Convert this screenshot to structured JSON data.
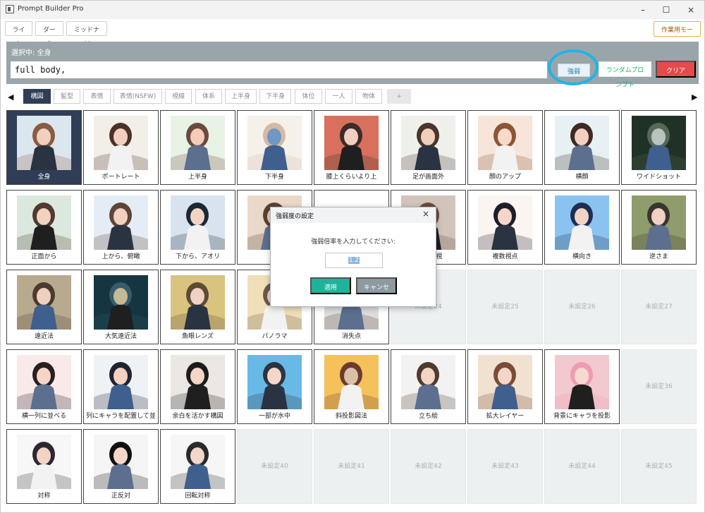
{
  "window": {
    "title": "Prompt Builder Pro"
  },
  "toolbar": {
    "themes": [
      "ライト",
      "ダーク",
      "ミッドナイト"
    ],
    "work_mode": "作業用モード"
  },
  "prompt": {
    "selected_label": "選択中: 全身",
    "value": "full body,",
    "strength_label": "強弱",
    "random_label": "ランダムプロンプト",
    "clear_label": "クリア"
  },
  "tabs": [
    "構図",
    "髪型",
    "表情",
    "表情(NSFW)",
    "視線",
    "体系",
    "上半身",
    "下半身",
    "体位",
    "一人",
    "物体",
    "+"
  ],
  "cards": [
    {
      "label": "全身",
      "icon": "full-body-image"
    },
    {
      "label": "ポートレート",
      "icon": "portrait-image"
    },
    {
      "label": "上半身",
      "icon": "upper-body-image"
    },
    {
      "label": "下半身",
      "icon": "lower-body-image"
    },
    {
      "label": "膝上くらいより上",
      "icon": "above-knees-image"
    },
    {
      "label": "足が画面外",
      "icon": "feet-out-of-frame-image"
    },
    {
      "label": "顔のアップ",
      "icon": "face-closeup-image"
    },
    {
      "label": "横顔",
      "icon": "profile-image"
    },
    {
      "label": "ワイドショット",
      "icon": "wide-shot-image"
    },
    {
      "label": "正面から",
      "icon": "from-front-image"
    },
    {
      "label": "上から、俯瞰",
      "icon": "from-above-image"
    },
    {
      "label": "下から、アオリ",
      "icon": "from-below-image"
    },
    {
      "label": "後",
      "icon": "from-behind-image"
    },
    {
      "label": "",
      "icon": "hidden-image"
    },
    {
      "label": "(斜めの視",
      "icon": "diagonal-view-image"
    },
    {
      "label": "複数視点",
      "icon": "multiple-views-image"
    },
    {
      "label": "横向き",
      "icon": "sideways-image"
    },
    {
      "label": "逆さま",
      "icon": "upside-down-image"
    },
    {
      "label": "遠近法",
      "icon": "perspective-image"
    },
    {
      "label": "大気遠近法",
      "icon": "aerial-perspective-image"
    },
    {
      "label": "魚眼レンズ",
      "icon": "fisheye-image"
    },
    {
      "label": "パノラマ",
      "icon": "panorama-image"
    },
    {
      "label": "消失点",
      "icon": "vanishing-point-image"
    },
    {
      "label": "未設定24",
      "icon": ""
    },
    {
      "label": "未設定25",
      "icon": ""
    },
    {
      "label": "未設定26",
      "icon": ""
    },
    {
      "label": "未設定27",
      "icon": ""
    },
    {
      "label": "横一列に並べる",
      "icon": "line-up-image"
    },
    {
      "label": "列にキャラを配置して並",
      "icon": "character-columns-image"
    },
    {
      "label": "余白を活かす構図",
      "icon": "negative-space-image"
    },
    {
      "label": "一部が水中",
      "icon": "partially-underwater-image"
    },
    {
      "label": "斜投影図法",
      "icon": "oblique-projection-image"
    },
    {
      "label": "立ち絵",
      "icon": "standing-image"
    },
    {
      "label": "拡大レイヤー",
      "icon": "enlarged-layer-image"
    },
    {
      "label": "背景にキャラを投影",
      "icon": "background-character-image"
    },
    {
      "label": "未設定36",
      "icon": ""
    },
    {
      "label": "対称",
      "icon": "symmetry-image"
    },
    {
      "label": "正反対",
      "icon": "opposite-image"
    },
    {
      "label": "回転対称",
      "icon": "rotational-symmetry-image"
    },
    {
      "label": "未設定40",
      "icon": ""
    },
    {
      "label": "未設定41",
      "icon": ""
    },
    {
      "label": "未設定42",
      "icon": ""
    },
    {
      "label": "未設定43",
      "icon": ""
    },
    {
      "label": "未設定44",
      "icon": ""
    },
    {
      "label": "未設定45",
      "icon": ""
    }
  ],
  "dialog": {
    "title": "強弱度の設定",
    "prompt": "強弱倍率を入力してください:",
    "value": "1.2",
    "apply": "適用",
    "cancel": "キャンセル"
  },
  "colors": {
    "selected_card": "#2f3d56",
    "apply": "#20b39b",
    "clear": "#e64b4b",
    "highlight": "#20b3ea"
  }
}
